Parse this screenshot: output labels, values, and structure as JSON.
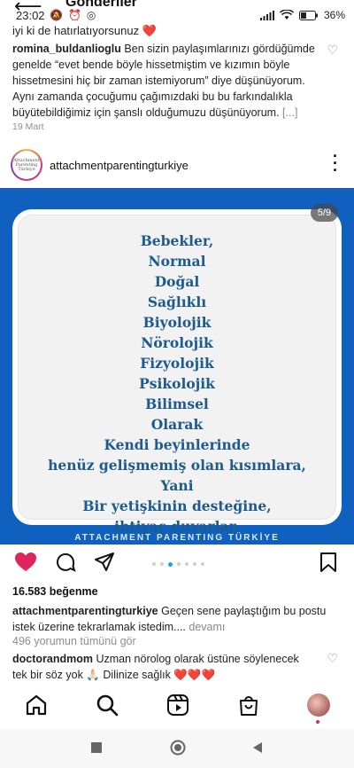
{
  "header": {
    "title": "Gönderiler"
  },
  "status_bar": {
    "time": "23:02",
    "battery": "36"
  },
  "top_text": "iyi ki de hatırlatıyorsunuz ❤️",
  "comment1": {
    "username": "romina_buldanlioglu",
    "text": "Ben sizin paylaşımlarınızı gördüğümde genelde “evet bende böyle hissetmiştim ve kızımın böyle hissetmesini hiç bir zaman istemiyorum” diye düşünüyorum. Aynı zamanda çocuğumu çağımızdaki bu bu farkındalıkla büyütebildiğimiz için şanslı olduğumuzu düşünüyorum.",
    "more": "[...]",
    "date": "19 Mart"
  },
  "post": {
    "username": "attachmentparentingturkiye",
    "avatar_text": "Attachment Parenting Türkiye",
    "counter": "5/9",
    "lines": [
      "Bebekler,",
      "Normal",
      "Doğal",
      "Sağlıklı",
      "Biyolojik",
      "Nörolojik",
      "Fizyolojik",
      "Psikolojik",
      "Bilimsel",
      "Olarak",
      "Kendi beyinlerinde",
      "henüz gelişmemiş olan kısımlara,",
      "Yani",
      "Bir yetişkinin desteğine,",
      "ihtiyaç duyarlar."
    ],
    "brand": "ATTACHMENT PARENTING TÜRKİYE",
    "likes": "16.583 beğenme",
    "caption_user": "attachmentparentingturkiye",
    "caption_text": "Geçen sene paylaştığım bu postu istek üzerine tekrarlamak istedim....",
    "caption_more": "devamı",
    "view_comments": "496 yorumun tümünü gör"
  },
  "comment2": {
    "username": "doctorandmom",
    "text": "Uzman nörolog olarak üstüne söylenecek tek bir söz yok 🙏🏻 Dilinize sağlık",
    "hearts": "❤️❤️❤️"
  },
  "colors": {
    "post_bg": "#1060c0",
    "heading_blue": "#1c5a8f",
    "like_red": "#e0245e",
    "dot_active": "#1aa1f1"
  }
}
